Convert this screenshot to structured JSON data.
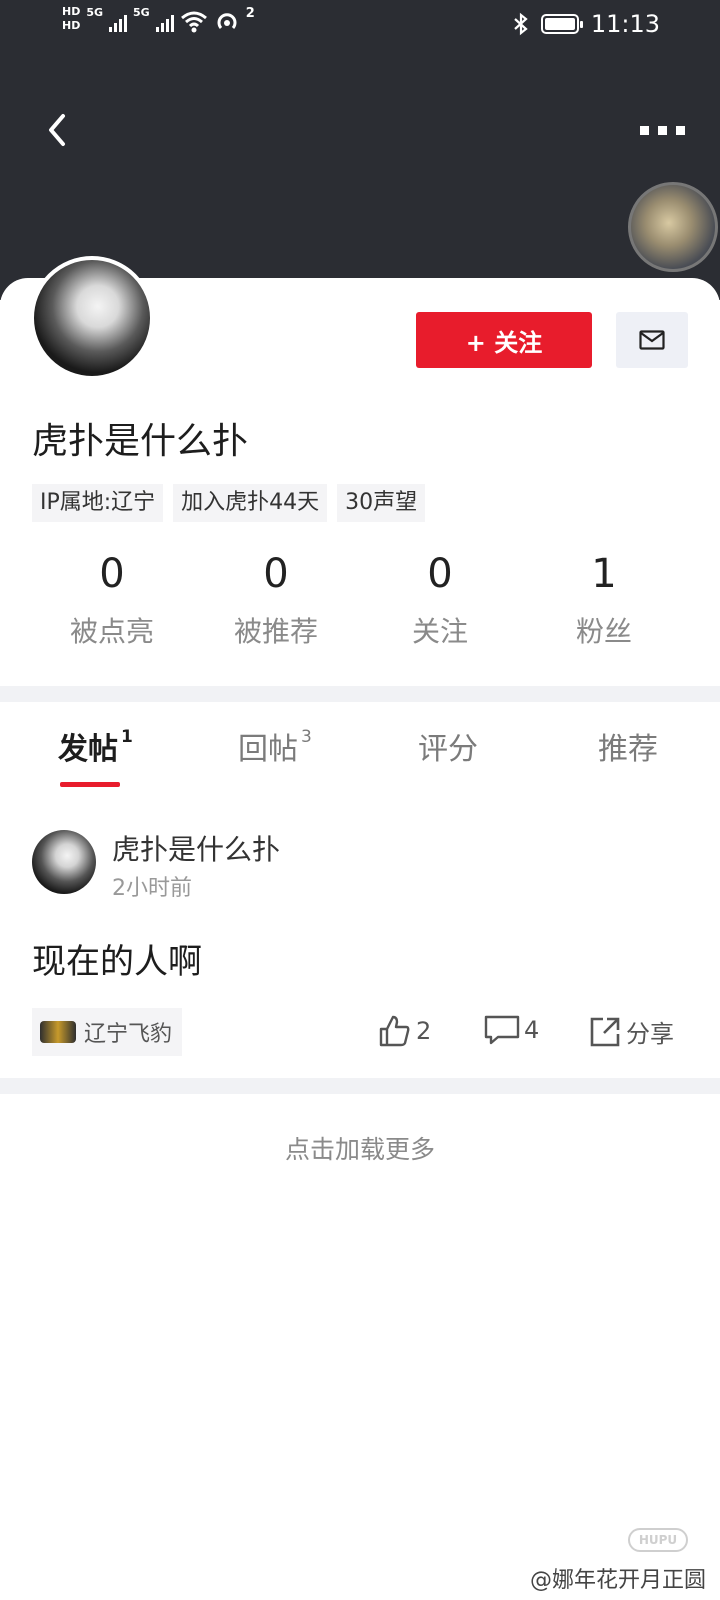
{
  "status_bar": {
    "hd1": "HD",
    "hd2": "HD",
    "net1": "5G",
    "net2": "5G",
    "hotspot_count": "2",
    "time": "11:13"
  },
  "header": {
    "back_icon": "chevron-left-icon",
    "more_icon": "more-dots-icon"
  },
  "profile": {
    "username": "虎扑是什么扑",
    "follow_label": "+ 关注",
    "tags": [
      "IP属地:辽宁",
      "加入虎扑44天",
      "30声望"
    ],
    "stats": [
      {
        "num": "0",
        "label": "被点亮"
      },
      {
        "num": "0",
        "label": "被推荐"
      },
      {
        "num": "0",
        "label": "关注"
      },
      {
        "num": "1",
        "label": "粉丝"
      }
    ]
  },
  "tabs": [
    {
      "label": "发帖",
      "count": "1"
    },
    {
      "label": "回帖",
      "count": "3"
    },
    {
      "label": "评分",
      "count": ""
    },
    {
      "label": "推荐",
      "count": ""
    }
  ],
  "post": {
    "author": "虎扑是什么扑",
    "time": "2小时前",
    "content": "现在的人啊",
    "team": "辽宁飞豹",
    "likes": "2",
    "comments": "4",
    "share_label": "分享"
  },
  "load_more": "点击加载更多",
  "watermark": {
    "logo_text": "HUPU",
    "text": "@娜年花开月正圆"
  },
  "colors": {
    "header_bg": "#2b2d33",
    "accent_red": "#e81c2c"
  }
}
